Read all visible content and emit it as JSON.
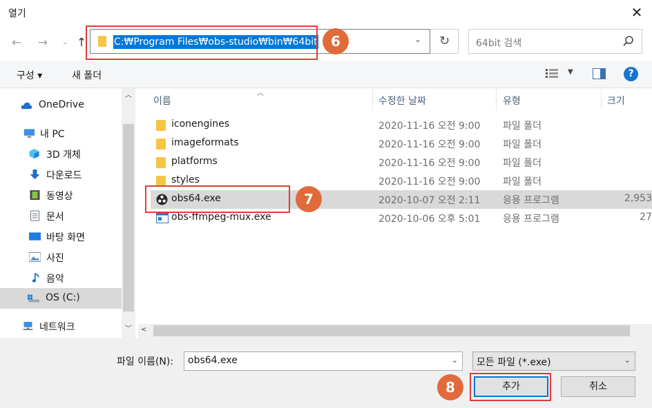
{
  "window": {
    "title": "열기"
  },
  "nav": {
    "address_path": "C:₩Program Files₩obs-studio₩bin₩64bit",
    "search_placeholder": "64bit 검색"
  },
  "toolbar": {
    "organize": "구성 ▾",
    "new_folder": "새 폴더"
  },
  "sidebar": {
    "items": [
      {
        "label": "OneDrive",
        "icon": "cloud-icon"
      },
      {
        "label": "내 PC",
        "icon": "computer-icon"
      },
      {
        "label": "3D 개체",
        "icon": "cube-icon"
      },
      {
        "label": "다운로드",
        "icon": "download-icon"
      },
      {
        "label": "동영상",
        "icon": "film-icon"
      },
      {
        "label": "문서",
        "icon": "document-icon"
      },
      {
        "label": "바탕 화면",
        "icon": "desktop-icon"
      },
      {
        "label": "사진",
        "icon": "picture-icon"
      },
      {
        "label": "음악",
        "icon": "music-icon"
      },
      {
        "label": "OS (C:)",
        "icon": "drive-icon"
      },
      {
        "label": "네트워크",
        "icon": "network-icon"
      }
    ]
  },
  "filelist": {
    "columns": [
      "이름",
      "수정한 날짜",
      "유형",
      "크기"
    ],
    "rows": [
      {
        "name": "iconengines",
        "date": "2020-11-16 오전 9:00",
        "type": "파일 폴더",
        "size": ""
      },
      {
        "name": "imageformats",
        "date": "2020-11-16 오전 9:00",
        "type": "파일 폴더",
        "size": ""
      },
      {
        "name": "platforms",
        "date": "2020-11-16 오전 9:00",
        "type": "파일 폴더",
        "size": ""
      },
      {
        "name": "styles",
        "date": "2020-11-16 오전 9:00",
        "type": "파일 폴더",
        "size": ""
      },
      {
        "name": "obs64.exe",
        "date": "2020-10-07 오전 2:11",
        "type": "응용 프로그램",
        "size": "2,953"
      },
      {
        "name": "obs-ffmpeg-mux.exe",
        "date": "2020-10-06 오후 5:01",
        "type": "응용 프로그램",
        "size": "27"
      }
    ]
  },
  "footer": {
    "filename_label": "파일 이름(N):",
    "filename_value": "obs64.exe",
    "filetype_value": "모든 파일 (*.exe)",
    "open_button": "추가",
    "cancel_button": "취소"
  },
  "markers": {
    "step6": "6",
    "step7": "7",
    "step8": "8"
  },
  "colors": {
    "accent": "#0078d7",
    "callout": "#e53935",
    "marker": "#e06a3a",
    "folder": "#f5c645"
  }
}
